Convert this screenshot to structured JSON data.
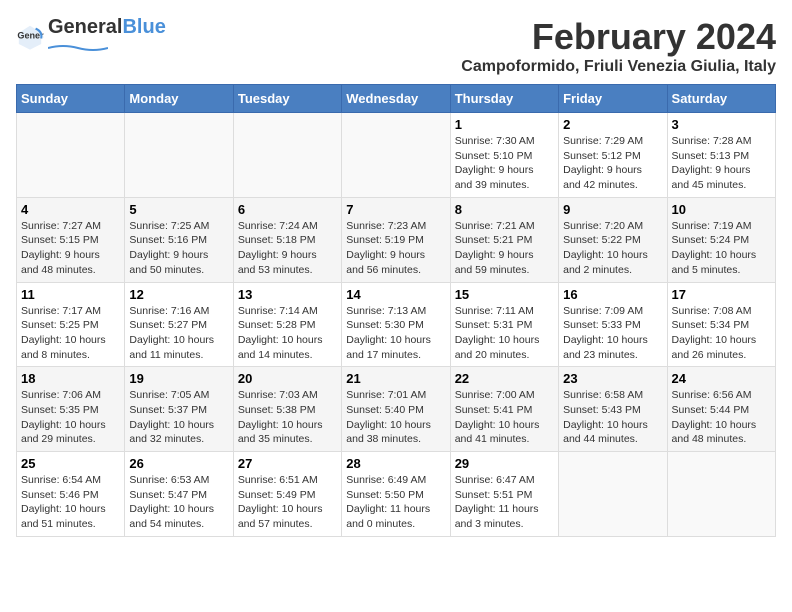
{
  "header": {
    "logo_general": "General",
    "logo_blue": "Blue",
    "title": "February 2024",
    "subtitle": "Campoformido, Friuli Venezia Giulia, Italy"
  },
  "days_of_week": [
    "Sunday",
    "Monday",
    "Tuesday",
    "Wednesday",
    "Thursday",
    "Friday",
    "Saturday"
  ],
  "weeks": [
    [
      {
        "day": "",
        "info": ""
      },
      {
        "day": "",
        "info": ""
      },
      {
        "day": "",
        "info": ""
      },
      {
        "day": "",
        "info": ""
      },
      {
        "day": "1",
        "info": "Sunrise: 7:30 AM\nSunset: 5:10 PM\nDaylight: 9 hours\nand 39 minutes."
      },
      {
        "day": "2",
        "info": "Sunrise: 7:29 AM\nSunset: 5:12 PM\nDaylight: 9 hours\nand 42 minutes."
      },
      {
        "day": "3",
        "info": "Sunrise: 7:28 AM\nSunset: 5:13 PM\nDaylight: 9 hours\nand 45 minutes."
      }
    ],
    [
      {
        "day": "4",
        "info": "Sunrise: 7:27 AM\nSunset: 5:15 PM\nDaylight: 9 hours\nand 48 minutes."
      },
      {
        "day": "5",
        "info": "Sunrise: 7:25 AM\nSunset: 5:16 PM\nDaylight: 9 hours\nand 50 minutes."
      },
      {
        "day": "6",
        "info": "Sunrise: 7:24 AM\nSunset: 5:18 PM\nDaylight: 9 hours\nand 53 minutes."
      },
      {
        "day": "7",
        "info": "Sunrise: 7:23 AM\nSunset: 5:19 PM\nDaylight: 9 hours\nand 56 minutes."
      },
      {
        "day": "8",
        "info": "Sunrise: 7:21 AM\nSunset: 5:21 PM\nDaylight: 9 hours\nand 59 minutes."
      },
      {
        "day": "9",
        "info": "Sunrise: 7:20 AM\nSunset: 5:22 PM\nDaylight: 10 hours\nand 2 minutes."
      },
      {
        "day": "10",
        "info": "Sunrise: 7:19 AM\nSunset: 5:24 PM\nDaylight: 10 hours\nand 5 minutes."
      }
    ],
    [
      {
        "day": "11",
        "info": "Sunrise: 7:17 AM\nSunset: 5:25 PM\nDaylight: 10 hours\nand 8 minutes."
      },
      {
        "day": "12",
        "info": "Sunrise: 7:16 AM\nSunset: 5:27 PM\nDaylight: 10 hours\nand 11 minutes."
      },
      {
        "day": "13",
        "info": "Sunrise: 7:14 AM\nSunset: 5:28 PM\nDaylight: 10 hours\nand 14 minutes."
      },
      {
        "day": "14",
        "info": "Sunrise: 7:13 AM\nSunset: 5:30 PM\nDaylight: 10 hours\nand 17 minutes."
      },
      {
        "day": "15",
        "info": "Sunrise: 7:11 AM\nSunset: 5:31 PM\nDaylight: 10 hours\nand 20 minutes."
      },
      {
        "day": "16",
        "info": "Sunrise: 7:09 AM\nSunset: 5:33 PM\nDaylight: 10 hours\nand 23 minutes."
      },
      {
        "day": "17",
        "info": "Sunrise: 7:08 AM\nSunset: 5:34 PM\nDaylight: 10 hours\nand 26 minutes."
      }
    ],
    [
      {
        "day": "18",
        "info": "Sunrise: 7:06 AM\nSunset: 5:35 PM\nDaylight: 10 hours\nand 29 minutes."
      },
      {
        "day": "19",
        "info": "Sunrise: 7:05 AM\nSunset: 5:37 PM\nDaylight: 10 hours\nand 32 minutes."
      },
      {
        "day": "20",
        "info": "Sunrise: 7:03 AM\nSunset: 5:38 PM\nDaylight: 10 hours\nand 35 minutes."
      },
      {
        "day": "21",
        "info": "Sunrise: 7:01 AM\nSunset: 5:40 PM\nDaylight: 10 hours\nand 38 minutes."
      },
      {
        "day": "22",
        "info": "Sunrise: 7:00 AM\nSunset: 5:41 PM\nDaylight: 10 hours\nand 41 minutes."
      },
      {
        "day": "23",
        "info": "Sunrise: 6:58 AM\nSunset: 5:43 PM\nDaylight: 10 hours\nand 44 minutes."
      },
      {
        "day": "24",
        "info": "Sunrise: 6:56 AM\nSunset: 5:44 PM\nDaylight: 10 hours\nand 48 minutes."
      }
    ],
    [
      {
        "day": "25",
        "info": "Sunrise: 6:54 AM\nSunset: 5:46 PM\nDaylight: 10 hours\nand 51 minutes."
      },
      {
        "day": "26",
        "info": "Sunrise: 6:53 AM\nSunset: 5:47 PM\nDaylight: 10 hours\nand 54 minutes."
      },
      {
        "day": "27",
        "info": "Sunrise: 6:51 AM\nSunset: 5:49 PM\nDaylight: 10 hours\nand 57 minutes."
      },
      {
        "day": "28",
        "info": "Sunrise: 6:49 AM\nSunset: 5:50 PM\nDaylight: 11 hours\nand 0 minutes."
      },
      {
        "day": "29",
        "info": "Sunrise: 6:47 AM\nSunset: 5:51 PM\nDaylight: 11 hours\nand 3 minutes."
      },
      {
        "day": "",
        "info": ""
      },
      {
        "day": "",
        "info": ""
      }
    ]
  ]
}
